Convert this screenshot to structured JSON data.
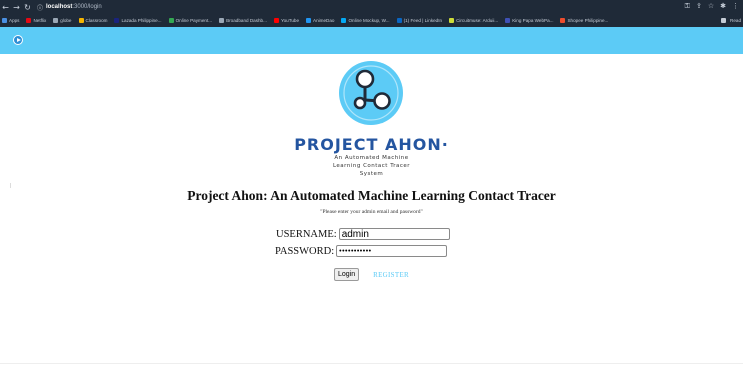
{
  "browser": {
    "url_host": "localhost",
    "url_path": ":3000/login",
    "bookmarks": [
      {
        "label": "Apps",
        "color": "#4a90e2"
      },
      {
        "label": "Netflix",
        "color": "#e50914"
      },
      {
        "label": "globe",
        "color": "#9aa7b5"
      },
      {
        "label": "Classroom",
        "color": "#f4b400"
      },
      {
        "label": "Lazada Philippine...",
        "color": "#1a237e"
      },
      {
        "label": "Online Payment...",
        "color": "#34a853"
      },
      {
        "label": "Broadband Dashb...",
        "color": "#9aa7b5"
      },
      {
        "label": "YouTube",
        "color": "#ff0000"
      },
      {
        "label": "AnimeDao",
        "color": "#2196f3"
      },
      {
        "label": "Online Mockup, W...",
        "color": "#03a9f4"
      },
      {
        "label": "(1) Feed | LinkedIn",
        "color": "#0a66c2"
      },
      {
        "label": "Circuitmuse: Arduii...",
        "color": "#cddc39"
      },
      {
        "label": "King Papa WebPa...",
        "color": "#3f51b5"
      },
      {
        "label": "Shopee Philippine...",
        "color": "#ee4d2d"
      }
    ],
    "reading_list": "Read"
  },
  "brand": {
    "name": "PROJECT AHON",
    "tagline_line1": "An Automated Machine",
    "tagline_line2": "Learning Contact Tracer",
    "tagline_line3": "System",
    "color": "#2455a0",
    "logo_color": "#5ccbf6"
  },
  "page": {
    "title": "Project Ahon: An Automated Machine Learning Contact Tracer",
    "instruction": "\"Please enter your admin email and password\""
  },
  "form": {
    "username_label": "USERNAME:",
    "username_value": "admin",
    "password_label": "PASSWORD:",
    "password_value": "•••••••••••",
    "login_label": "Login",
    "register_label": "REGISTER"
  },
  "colors": {
    "header": "#5ccbf6",
    "register": "#5ccbf6"
  }
}
